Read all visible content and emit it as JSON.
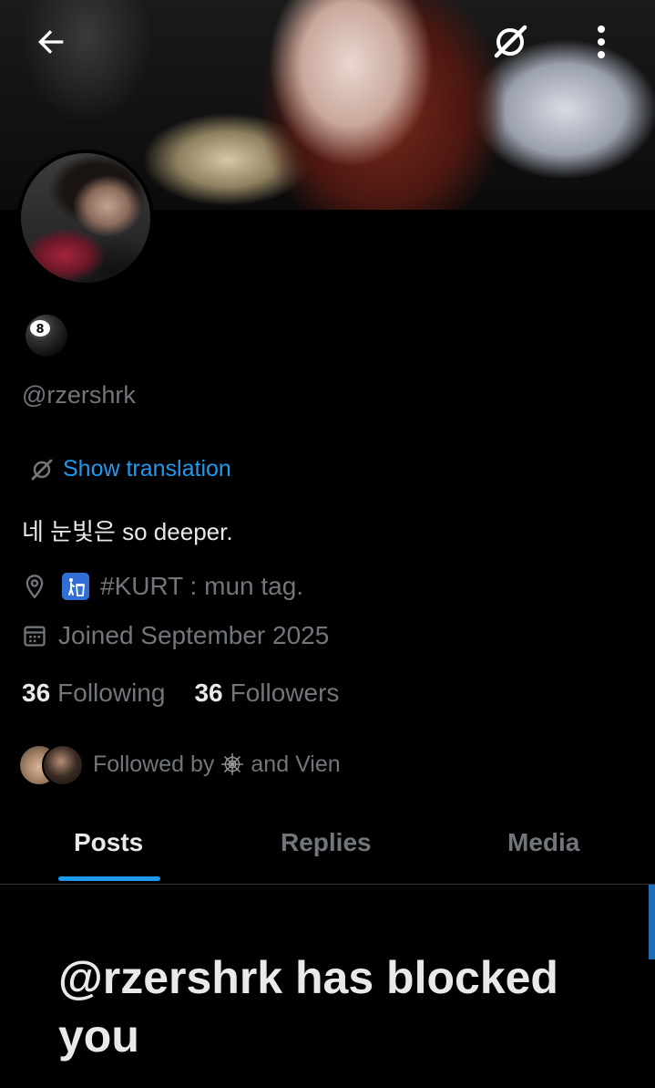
{
  "profile": {
    "name_emoji": "8-ball",
    "handle": "@rzershrk",
    "translate_label": "Show translation",
    "bio": "네 눈빛은 so deeper.",
    "location_emoji": "litter-in-bin",
    "location": "#KURT : mun tag.",
    "joined": "Joined September 2025"
  },
  "stats": {
    "following_count": "36",
    "following_label": "Following",
    "followers_count": "36",
    "followers_label": "Followers"
  },
  "followed_by": {
    "prefix": "Followed by",
    "middle": "and Vien"
  },
  "tabs": [
    {
      "label": "Posts",
      "active": true
    },
    {
      "label": "Replies",
      "active": false
    },
    {
      "label": "Media",
      "active": false
    }
  ],
  "blocked_message": "@rzershrk has blocked you",
  "colors": {
    "accent": "#1d9bf0",
    "background": "#000000",
    "text_primary": "#e7e9ea",
    "text_secondary": "#71767b"
  }
}
